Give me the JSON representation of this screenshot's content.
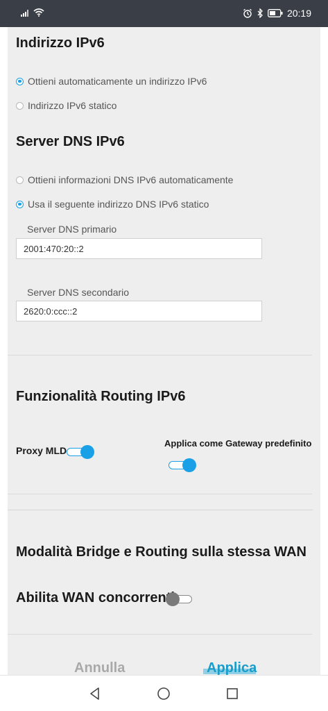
{
  "status_bar": {
    "time": "20:19",
    "icons": [
      "signal-icon",
      "wifi-icon",
      "alarm-icon",
      "bluetooth-icon",
      "battery-icon"
    ]
  },
  "ipv6_address": {
    "title": "Indirizzo IPv6",
    "options": [
      {
        "label": "Ottieni automaticamente un indirizzo IPv6",
        "checked": true
      },
      {
        "label": "Indirizzo IPv6 statico",
        "checked": false
      }
    ]
  },
  "dns": {
    "title": "Server DNS IPv6",
    "options": [
      {
        "label": "Ottieni informazioni DNS IPv6 automaticamente",
        "checked": false
      },
      {
        "label": "Usa il seguente indirizzo DNS IPv6 statico",
        "checked": true
      }
    ],
    "primary_label": "Server DNS primario",
    "primary_value": "2001:470:20::2",
    "secondary_label": "Server DNS secondario",
    "secondary_value": "2620:0:ccc::2"
  },
  "routing": {
    "title": "Funzionalità Routing IPv6",
    "proxy_mld_label": "Proxy MLD",
    "proxy_mld_on": true,
    "gateway_label": "Applica come Gateway predefinito",
    "gateway_on": true
  },
  "bridge": {
    "title": "Modalità Bridge e Routing sulla stessa WAN",
    "concurrent_label": "Abilita WAN concorrenti",
    "concurrent_on": false
  },
  "actions": {
    "cancel_label": "Annulla",
    "apply_label": "Applica"
  },
  "colors": {
    "accent": "#1aa0e6",
    "status_bar": "#3a3f47",
    "page_bg": "#eeeeee"
  }
}
